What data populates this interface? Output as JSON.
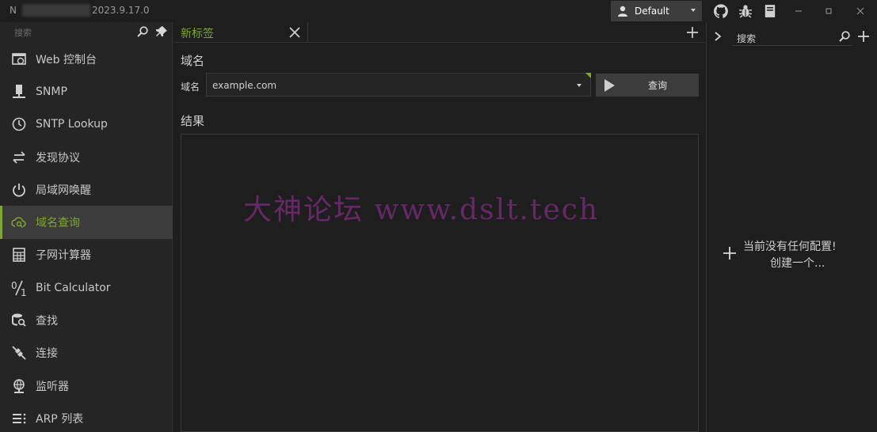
{
  "titlebar": {
    "app_name_prefix": "N",
    "version": "2023.9.17.0",
    "profile_label": "Default",
    "icons": [
      "user-icon",
      "github-icon",
      "bug-icon",
      "document-icon"
    ],
    "window_controls": [
      "minimize",
      "restore",
      "close"
    ]
  },
  "sidebar": {
    "search_placeholder": "搜索",
    "items": [
      {
        "label": "Web 控制台",
        "icon": "web-console-icon"
      },
      {
        "label": "SNMP",
        "icon": "snmp-icon"
      },
      {
        "label": "SNTP Lookup",
        "icon": "clock-icon"
      },
      {
        "label": "发现协议",
        "icon": "swap-arrows-icon"
      },
      {
        "label": "局域网唤醒",
        "icon": "power-icon"
      },
      {
        "label": "域名查询",
        "icon": "cloud-search-icon",
        "active": true
      },
      {
        "label": "子网计算器",
        "icon": "calculator-icon"
      },
      {
        "label": "Bit Calculator",
        "icon": "fraction-icon"
      },
      {
        "label": "查找",
        "icon": "find-icon"
      },
      {
        "label": "连接",
        "icon": "connect-icon"
      },
      {
        "label": "监听器",
        "icon": "globe-listener-icon"
      },
      {
        "label": "ARP 列表",
        "icon": "list-icon"
      }
    ]
  },
  "main": {
    "tab_label": "新标签",
    "section_domain": "域名",
    "field_label": "域名",
    "domain_value": "example.com",
    "query_button": "查询",
    "section_results": "结果"
  },
  "watermark": "大神论坛  www.dslt.tech",
  "right_panel": {
    "search_text": "搜索",
    "empty_line1": "当前没有任何配置!",
    "empty_line2": "创建一个..."
  },
  "colors": {
    "accent": "#7ea82b",
    "background": "#1e1e1e",
    "sidebar": "#252525",
    "button": "#3c3c3c"
  }
}
